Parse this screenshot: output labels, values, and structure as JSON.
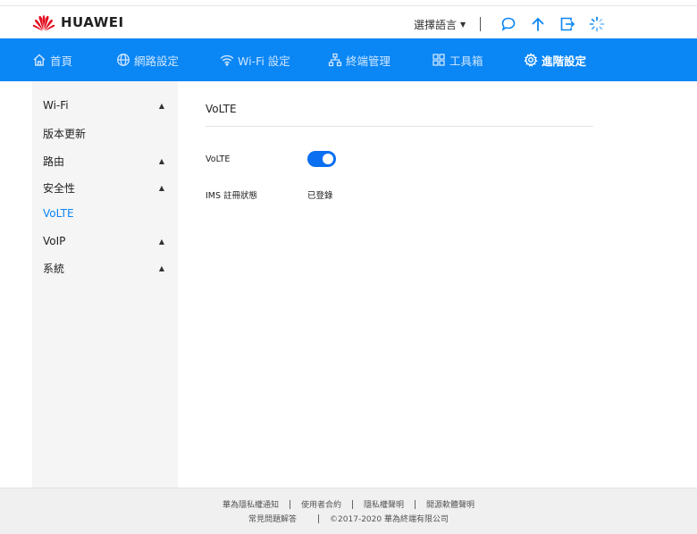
{
  "header": {
    "brand": "HUAWEI",
    "language_label": "選擇語言",
    "icons": [
      "chat-icon",
      "upload-icon",
      "logout-icon",
      "loading-icon"
    ]
  },
  "nav": {
    "items": [
      {
        "label": "首頁",
        "icon": "home-icon",
        "active": false
      },
      {
        "label": "網路設定",
        "icon": "globe-icon",
        "active": false
      },
      {
        "label": "Wi-Fi 設定",
        "icon": "wifi-icon",
        "active": false
      },
      {
        "label": "終端管理",
        "icon": "network-icon",
        "active": false
      },
      {
        "label": "工具箱",
        "icon": "grid-icon",
        "active": false
      },
      {
        "label": "進階設定",
        "icon": "gear-icon",
        "active": true
      }
    ]
  },
  "sidebar": {
    "items": [
      {
        "label": "Wi-Fi",
        "expandable": true
      },
      {
        "label": "版本更新",
        "expandable": false
      },
      {
        "label": "路由",
        "expandable": true
      },
      {
        "label": "安全性",
        "expandable": true
      },
      {
        "label": "VoLTE",
        "expandable": false,
        "active": true
      },
      {
        "label": "VoIP",
        "expandable": true
      },
      {
        "label": "系統",
        "expandable": true
      }
    ]
  },
  "content": {
    "title": "VoLTE",
    "volte_label": "VoLTE",
    "volte_enabled": true,
    "ims_label": "IMS 註冊狀態",
    "ims_value": "已登錄"
  },
  "footer": {
    "links_row1": [
      "華為隱私權通知",
      "使用者合約",
      "隱私權聲明",
      "開源軟體聲明"
    ],
    "faq": "常見問題解答",
    "copyright": "©2017-2020 華為終端有限公司"
  },
  "colors": {
    "nav_bg": "#0a86f5",
    "accent": "#0a86f5",
    "toggle_on": "#0a6ff0",
    "sidebar_bg": "#f5f5f5",
    "footer_bg": "#f0f0f0"
  }
}
